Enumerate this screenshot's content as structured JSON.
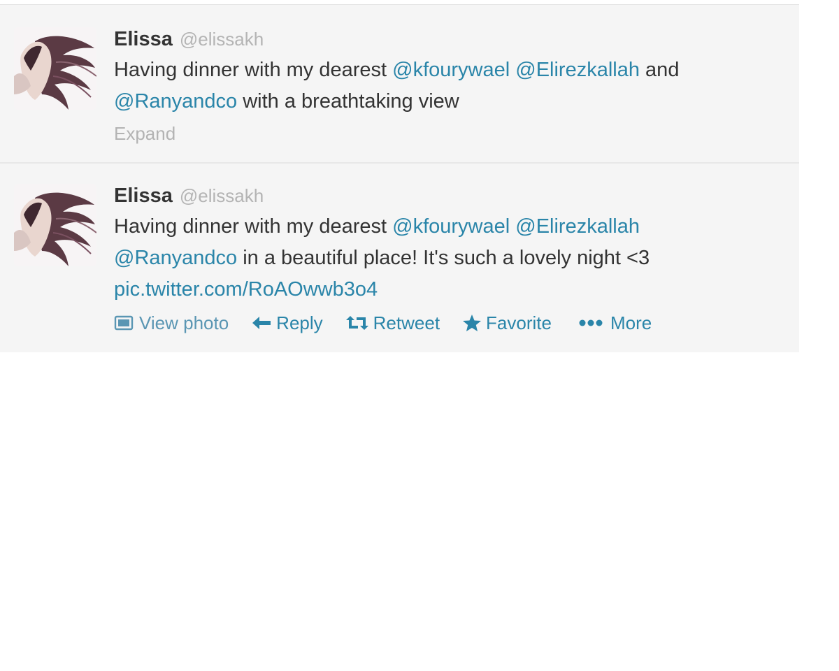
{
  "tweets": [
    {
      "fullname": "Elissa",
      "username": "@elissakh",
      "text": {
        "t1": "Having dinner with my dearest ",
        "m1": "@kfourywael",
        "t2": " ",
        "m2": "@Elirezkallah",
        "t3": " and ",
        "m3": "@Ranyandco",
        "t4": " with a breathtaking view"
      },
      "expand_label": "Expand"
    },
    {
      "fullname": "Elissa",
      "username": "@elissakh",
      "text": {
        "t1": "Having dinner with my dearest ",
        "m1": "@kfourywael",
        "t2": " ",
        "m2": "@Elirezkallah",
        "m3": "@Ranyandco",
        "t3": " in a beautiful place! It's such a lovely night <3",
        "link": "pic.twitter.com/RoAOwwb3o4"
      },
      "actions": {
        "view_photo": "View photo",
        "reply": "Reply",
        "retweet": "Retweet",
        "favorite": "Favorite",
        "more": "More"
      }
    }
  ],
  "icons": {
    "view_photo": "photo-icon",
    "reply": "reply-arrow-icon",
    "retweet": "retweet-icon",
    "favorite": "star-icon",
    "more": "ellipsis-icon"
  },
  "colors": {
    "link": "#2a85a9",
    "username": "#b4b4b4",
    "tweet_background": "#f5f5f5",
    "text": "#333333"
  }
}
